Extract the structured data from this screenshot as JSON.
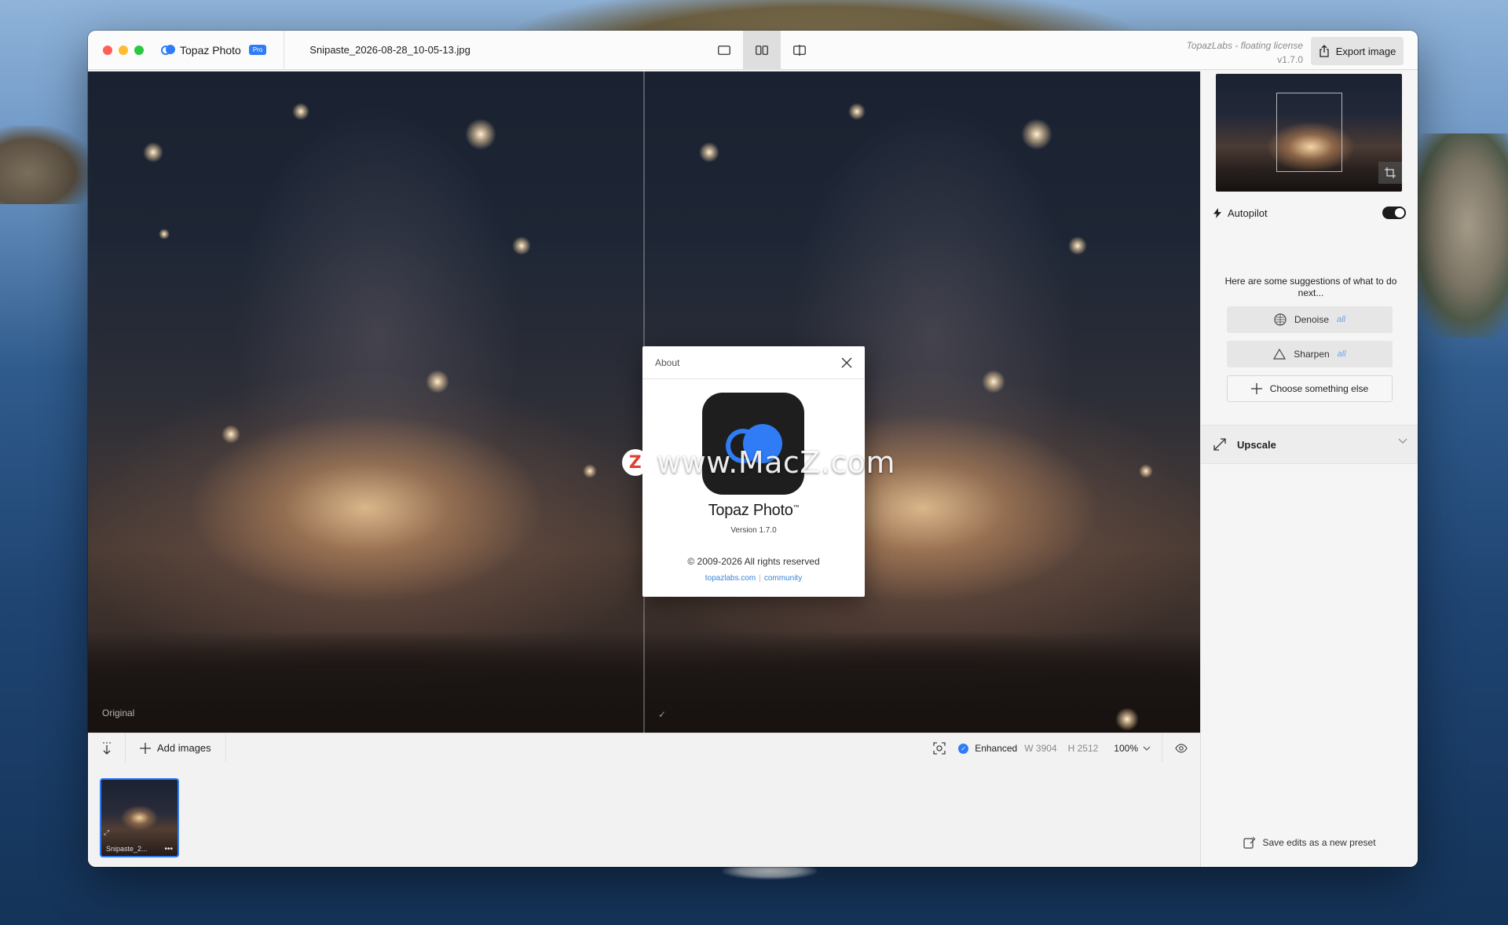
{
  "app": {
    "name": "Topaz Photo",
    "badge": "Pro",
    "filename": "Snipaste_2026-08-28_10-05-13.jpg",
    "license": "TopazLabs - floating license",
    "version": "v1.7.0",
    "export_label": "Export image"
  },
  "view_modes": [
    {
      "icon": "single-view-icon",
      "active": false
    },
    {
      "icon": "side-by-side-view-icon",
      "active": true
    },
    {
      "icon": "split-view-icon",
      "active": false
    }
  ],
  "canvas": {
    "left_label": "Original",
    "right_mark": "✓"
  },
  "about_modal": {
    "title": "About",
    "app_name": "Topaz Photo",
    "trademark": "™",
    "version": "Version 1.7.0",
    "copyright": "© 2009-2026 All rights reserved",
    "link_site": "topazlabs.com",
    "link_community": "community"
  },
  "watermark": {
    "glyph": "Z",
    "text": "www.MacZ.com"
  },
  "bottom_bar": {
    "add_images": "Add images",
    "enhanced": "Enhanced",
    "width": "W 3904",
    "height": "H 2512",
    "zoom": "100%"
  },
  "filmstrip": [
    {
      "name": "Snipaste_2...",
      "selected": true
    }
  ],
  "sidebar": {
    "autopilot": "Autopilot",
    "autopilot_on": true,
    "suggestions_intro": "Here are some suggestions of what to do next...",
    "suggestions": [
      {
        "label": "Denoise",
        "tag": "all",
        "icon": "denoise-icon"
      },
      {
        "label": "Sharpen",
        "tag": "all",
        "icon": "sharpen-icon"
      }
    ],
    "choose_other": "Choose something else",
    "upscale": "Upscale",
    "save_preset": "Save edits as a new preset"
  },
  "colors": {
    "accent": "#2f7cf6",
    "link": "#3d82d8"
  }
}
